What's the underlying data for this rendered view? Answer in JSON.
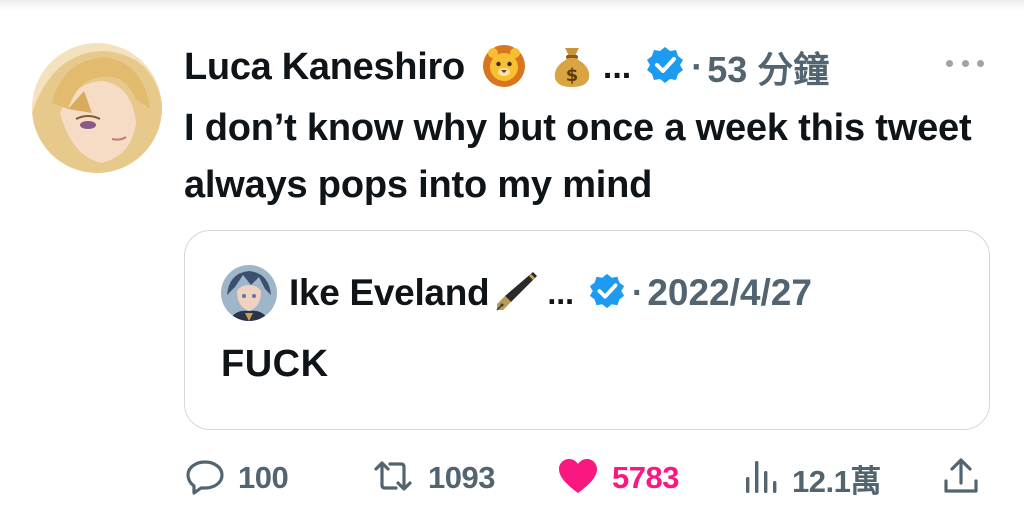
{
  "tweet": {
    "author_name": "Luca Kaneshiro",
    "author_emojis": [
      "lion-face-emoji",
      "money-bag-emoji"
    ],
    "name_ellipsis": "...",
    "separator": "·",
    "time": "53 分鐘",
    "text": "I don’t know why but once a week this tweet always pops into my mind"
  },
  "quoted_tweet": {
    "author_name": "Ike Eveland",
    "author_emoji": "fountain-pen-emoji",
    "name_ellipsis": "...",
    "separator": "·",
    "date": "2022/4/27",
    "text": "FUCK"
  },
  "actions": {
    "reply_count": "100",
    "retweet_count": "1093",
    "like_count": "5783",
    "view_count": "12.1萬"
  },
  "colors": {
    "text": "#0f1419",
    "secondary": "#536471",
    "verified": "#1d9bf0",
    "like": "#f91880",
    "border": "#cfd9de"
  }
}
